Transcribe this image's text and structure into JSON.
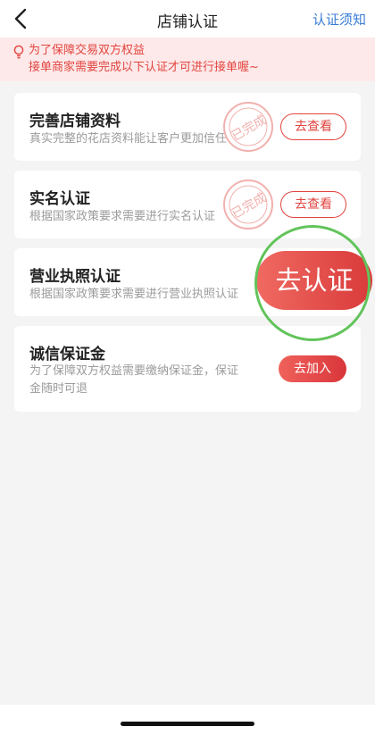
{
  "nav": {
    "title": "店铺认证",
    "right_link": "认证须知"
  },
  "notice": {
    "line1": "为了保障交易双方权益",
    "line2": "接单商家需要完成以下认证才可进行接单喔~"
  },
  "cards": [
    {
      "title": "完善店铺资料",
      "desc": "真实完整的花店资料能让客户更加信任",
      "button": "去查看",
      "stamp": "已完成"
    },
    {
      "title": "实名认证",
      "desc": "根据国家政策要求需要进行实名认证",
      "button": "去查看",
      "stamp": "已完成"
    },
    {
      "title": "营业执照认证",
      "desc": "根据国家政策要求需要进行营业执照认证",
      "button": "去认证"
    },
    {
      "title": "诚信保证金",
      "desc_line1": "为了保障双方权益需要缴纳保证金，保证",
      "desc_line2": "金随时可退",
      "button": "去加入"
    }
  ],
  "colors": {
    "accent": "#e2443f",
    "link": "#3a7bd5",
    "highlight_ring": "#62c45a"
  }
}
